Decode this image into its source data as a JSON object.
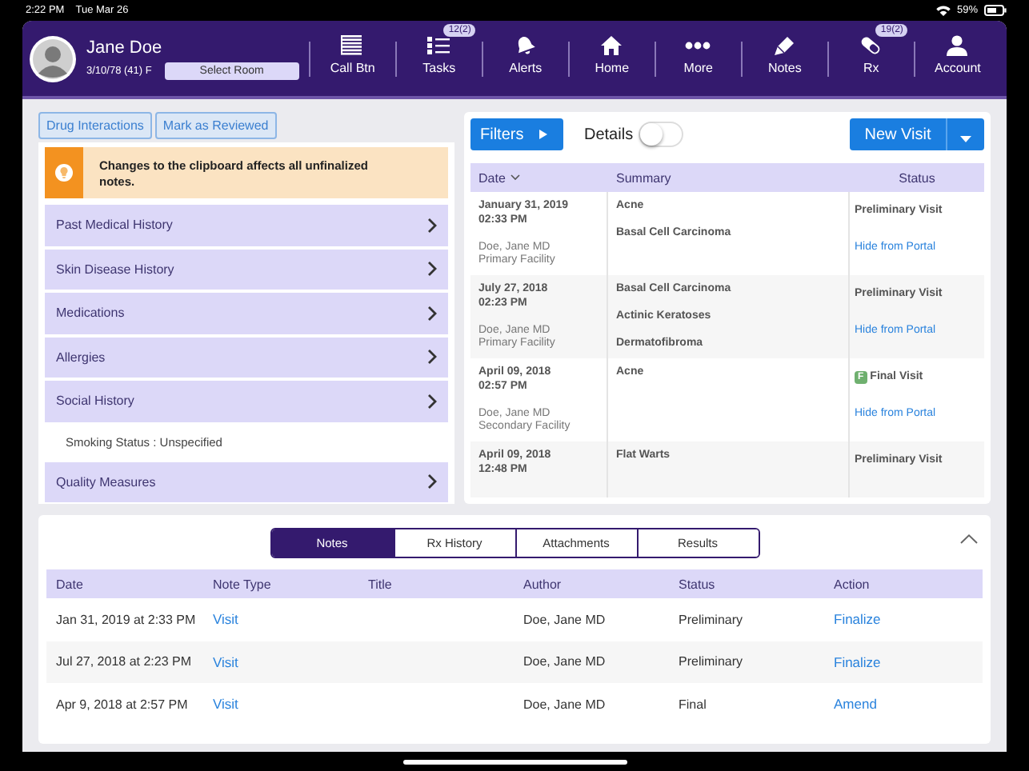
{
  "status_bar": {
    "time": "2:22 PM",
    "date": "Tue Mar 26",
    "battery": "59%"
  },
  "patient": {
    "name": "Jane Doe",
    "info": "3/10/78 (41) F",
    "room_button": "Select Room"
  },
  "nav": [
    {
      "label": "Call Btn",
      "kind": "lines"
    },
    {
      "label": "Tasks",
      "kind": "checklist",
      "badge": "12(2)"
    },
    {
      "label": "Alerts",
      "kind": "bell"
    },
    {
      "label": "Home",
      "kind": "house"
    },
    {
      "label": "More",
      "kind": "dots"
    },
    {
      "label": "Notes",
      "kind": "pen"
    },
    {
      "label": "Rx",
      "kind": "pill",
      "badge": "19(2)"
    },
    {
      "label": "Account",
      "kind": "person"
    }
  ],
  "clipboard": {
    "buttons": [
      "Drug Interactions",
      "Mark as Reviewed"
    ],
    "banner": "Changes to the clipboard affects all unfinalized notes.",
    "sections": [
      {
        "label": "Past Medical History"
      },
      {
        "label": "Skin Disease History"
      },
      {
        "label": "Medications"
      },
      {
        "label": "Allergies"
      },
      {
        "label": "Social History",
        "children": [
          "Smoking Status : Unspecified"
        ]
      },
      {
        "label": "Quality Measures"
      }
    ]
  },
  "visits": {
    "filters_button": "Filters",
    "details_label": "Details",
    "details_on": false,
    "new_visit_button": "New Visit",
    "columns": [
      "Date",
      "Summary",
      "Status"
    ],
    "rows": [
      {
        "date": "January 31, 2019",
        "time": "02:33 PM",
        "provider": "Doe, Jane MD",
        "facility": "Primary Facility",
        "diagnoses": [
          "Acne",
          "Basal Cell Carcinoma"
        ],
        "status": {
          "kind": "preliminary",
          "label": "Preliminary Visit"
        },
        "link": "Hide from Portal"
      },
      {
        "date": "July 27, 2018",
        "time": "02:23 PM",
        "provider": "Doe, Jane MD",
        "facility": "Primary Facility",
        "diagnoses": [
          "Basal Cell Carcinoma",
          "Actinic Keratoses",
          "Dermatofibroma"
        ],
        "status": {
          "kind": "preliminary",
          "label": "Preliminary Visit"
        },
        "link": "Hide from Portal"
      },
      {
        "date": "April 09, 2018",
        "time": "02:57 PM",
        "provider": "Doe, Jane MD",
        "facility": "Secondary Facility",
        "diagnoses": [
          "Acne"
        ],
        "status": {
          "kind": "final",
          "label": "Final Visit",
          "badge": "F"
        },
        "link": "Hide from Portal"
      },
      {
        "date": "April 09, 2018",
        "time": "12:48 PM",
        "diagnoses": [
          "Flat Warts"
        ],
        "status": {
          "kind": "preliminary",
          "label": "Preliminary Visit"
        }
      }
    ]
  },
  "notes": {
    "tabs": [
      {
        "label": "Notes",
        "selected": true
      },
      {
        "label": "Rx History",
        "selected": false
      },
      {
        "label": "Attachments",
        "selected": false
      },
      {
        "label": "Results",
        "selected": false
      }
    ],
    "columns": [
      "Date",
      "Note Type",
      "Title",
      "Author",
      "Status",
      "Action"
    ],
    "rows": [
      {
        "date": "Jan 31, 2019 at 2:33 PM",
        "type": "Visit",
        "author": "Doe, Jane MD",
        "status": "Preliminary",
        "action": "Finalize"
      },
      {
        "date": "Jul 27, 2018 at 2:23 PM",
        "type": "Visit",
        "author": "Doe, Jane MD",
        "status": "Preliminary",
        "action": "Finalize"
      },
      {
        "date": "Apr 9, 2018 at 2:57 PM",
        "type": "Visit",
        "author": "Doe, Jane MD",
        "status": "Final",
        "action": "Amend"
      }
    ]
  }
}
